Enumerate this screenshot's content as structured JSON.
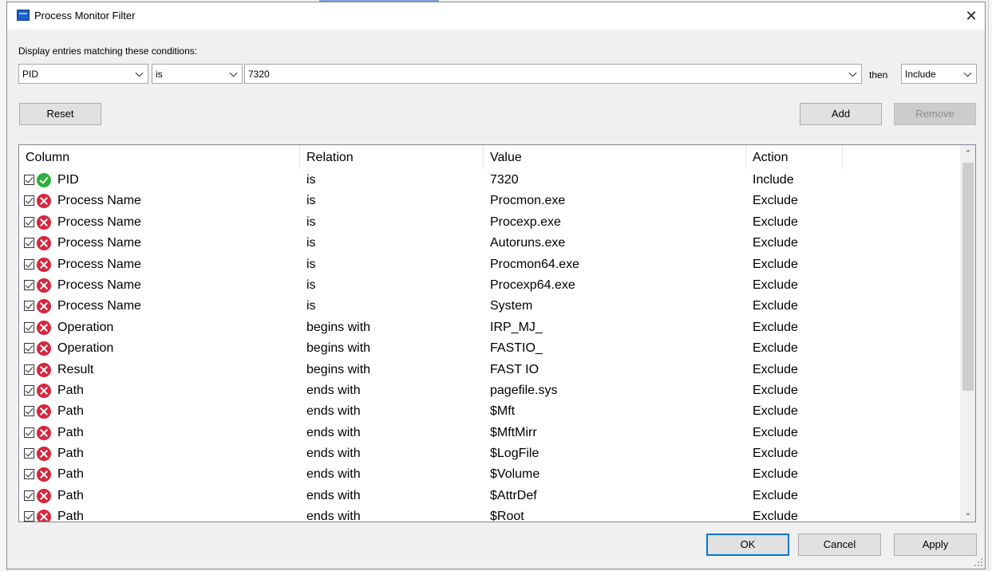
{
  "window": {
    "title": "Process Monitor Filter",
    "close_glyph": "✕"
  },
  "filter": {
    "prompt": "Display entries matching these conditions:",
    "column_value": "PID",
    "relation_value": "is",
    "value_value": "7320",
    "then_label": "then",
    "action_value": "Include"
  },
  "buttons": {
    "reset": "Reset",
    "add": "Add",
    "remove": "Remove",
    "ok": "OK",
    "cancel": "Cancel",
    "apply": "Apply"
  },
  "table": {
    "headers": [
      "Column",
      "Relation",
      "Value",
      "Action"
    ],
    "rows": [
      {
        "column": "PID",
        "relation": "is",
        "value": "7320",
        "action": "Include",
        "status": "include"
      },
      {
        "column": "Process Name",
        "relation": "is",
        "value": "Procmon.exe",
        "action": "Exclude",
        "status": "exclude"
      },
      {
        "column": "Process Name",
        "relation": "is",
        "value": "Procexp.exe",
        "action": "Exclude",
        "status": "exclude"
      },
      {
        "column": "Process Name",
        "relation": "is",
        "value": "Autoruns.exe",
        "action": "Exclude",
        "status": "exclude"
      },
      {
        "column": "Process Name",
        "relation": "is",
        "value": "Procmon64.exe",
        "action": "Exclude",
        "status": "exclude"
      },
      {
        "column": "Process Name",
        "relation": "is",
        "value": "Procexp64.exe",
        "action": "Exclude",
        "status": "exclude"
      },
      {
        "column": "Process Name",
        "relation": "is",
        "value": "System",
        "action": "Exclude",
        "status": "exclude"
      },
      {
        "column": "Operation",
        "relation": "begins with",
        "value": "IRP_MJ_",
        "action": "Exclude",
        "status": "exclude"
      },
      {
        "column": "Operation",
        "relation": "begins with",
        "value": "FASTIO_",
        "action": "Exclude",
        "status": "exclude"
      },
      {
        "column": "Result",
        "relation": "begins with",
        "value": "FAST IO",
        "action": "Exclude",
        "status": "exclude"
      },
      {
        "column": "Path",
        "relation": "ends with",
        "value": "pagefile.sys",
        "action": "Exclude",
        "status": "exclude"
      },
      {
        "column": "Path",
        "relation": "ends with",
        "value": "$Mft",
        "action": "Exclude",
        "status": "exclude"
      },
      {
        "column": "Path",
        "relation": "ends with",
        "value": "$MftMirr",
        "action": "Exclude",
        "status": "exclude"
      },
      {
        "column": "Path",
        "relation": "ends with",
        "value": "$LogFile",
        "action": "Exclude",
        "status": "exclude"
      },
      {
        "column": "Path",
        "relation": "ends with",
        "value": "$Volume",
        "action": "Exclude",
        "status": "exclude"
      },
      {
        "column": "Path",
        "relation": "ends with",
        "value": "$AttrDef",
        "action": "Exclude",
        "status": "exclude"
      },
      {
        "column": "Path",
        "relation": "ends with",
        "value": "$Root",
        "action": "Exclude",
        "status": "exclude"
      }
    ]
  },
  "icons": {
    "app": "process-monitor-icon",
    "include": "green-check-circle-icon",
    "exclude": "red-x-circle-icon"
  },
  "colors": {
    "include": "#2fae3b",
    "exclude": "#d7263d",
    "accent": "#0078d7"
  }
}
